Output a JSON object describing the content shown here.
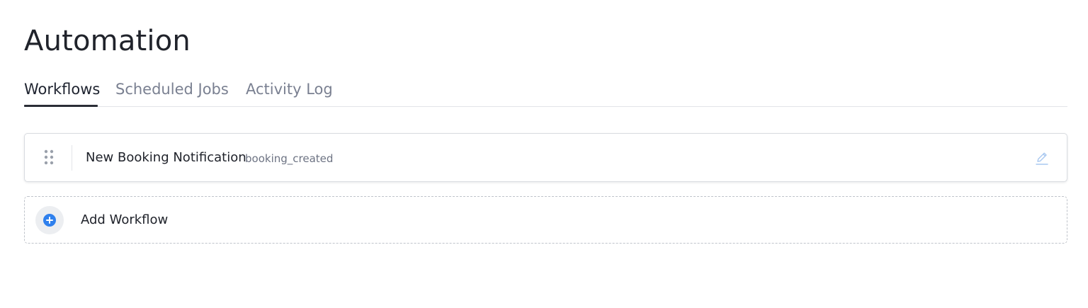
{
  "page": {
    "title": "Automation"
  },
  "tabs": [
    {
      "label": "Workflows",
      "active": true
    },
    {
      "label": "Scheduled Jobs",
      "active": false
    },
    {
      "label": "Activity Log",
      "active": false
    }
  ],
  "workflows": [
    {
      "name": "New Booking Notification",
      "trigger": "booking_created",
      "drag_icon": "drag-handle-icon",
      "edit_icon": "pencil-icon"
    }
  ],
  "add_workflow": {
    "label": "Add Workflow",
    "icon": "plus-circle-icon"
  },
  "colors": {
    "accent": "#2f80ed",
    "edit_icon": "#a9c8f0",
    "text_primary": "#20232b",
    "text_muted": "#7a8091"
  }
}
